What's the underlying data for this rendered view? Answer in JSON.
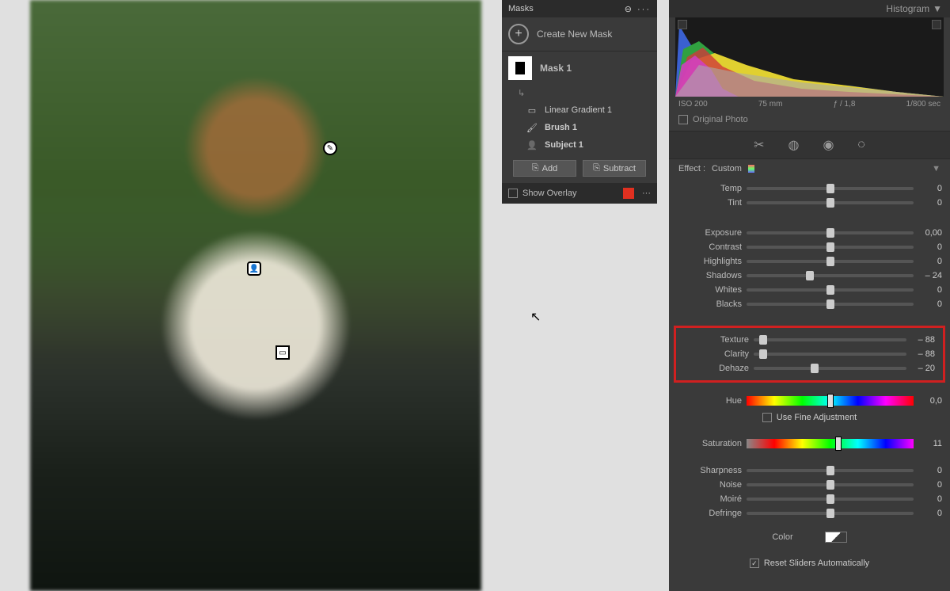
{
  "masks_panel": {
    "title": "Masks",
    "create_label": "Create New Mask",
    "mask1_label": "Mask 1",
    "components": [
      {
        "icon": "▭",
        "label": "Linear Gradient 1"
      },
      {
        "icon": "🖌",
        "label": "Brush 1"
      },
      {
        "icon": "👤",
        "label": "Subject 1"
      }
    ],
    "add_label": "Add",
    "subtract_label": "Subtract",
    "show_overlay": "Show Overlay"
  },
  "histogram": {
    "title": "Histogram",
    "iso": "ISO 200",
    "focal": "75 mm",
    "aperture": "ƒ / 1,8",
    "shutter": "1/800 sec",
    "original": "Original Photo"
  },
  "effect": {
    "label": "Effect :",
    "preset": "Custom"
  },
  "sliders_wb": [
    {
      "label": "Temp",
      "value": "0",
      "pos": 50
    },
    {
      "label": "Tint",
      "value": "0",
      "pos": 50
    }
  ],
  "sliders_tone": [
    {
      "label": "Exposure",
      "value": "0,00",
      "pos": 50
    },
    {
      "label": "Contrast",
      "value": "0",
      "pos": 50
    },
    {
      "label": "Highlights",
      "value": "0",
      "pos": 50
    },
    {
      "label": "Shadows",
      "value": "– 24",
      "pos": 38
    },
    {
      "label": "Whites",
      "value": "0",
      "pos": 50
    },
    {
      "label": "Blacks",
      "value": "0",
      "pos": 50
    }
  ],
  "sliders_detail": [
    {
      "label": "Texture",
      "value": "– 88",
      "pos": 6
    },
    {
      "label": "Clarity",
      "value": "– 88",
      "pos": 6
    },
    {
      "label": "Dehaze",
      "value": "– 20",
      "pos": 40
    }
  ],
  "hue": {
    "label": "Hue",
    "value": "0,0",
    "pos": 50,
    "fine": "Use Fine Adjustment"
  },
  "saturation": {
    "label": "Saturation",
    "value": "11",
    "pos": 55
  },
  "sliders_other": [
    {
      "label": "Sharpness",
      "value": "0",
      "pos": 50
    },
    {
      "label": "Noise",
      "value": "0",
      "pos": 50
    },
    {
      "label": "Moiré",
      "value": "0",
      "pos": 50
    },
    {
      "label": "Defringe",
      "value": "0",
      "pos": 50
    }
  ],
  "color_label": "Color",
  "reset_label": "Reset Sliders Automatically"
}
